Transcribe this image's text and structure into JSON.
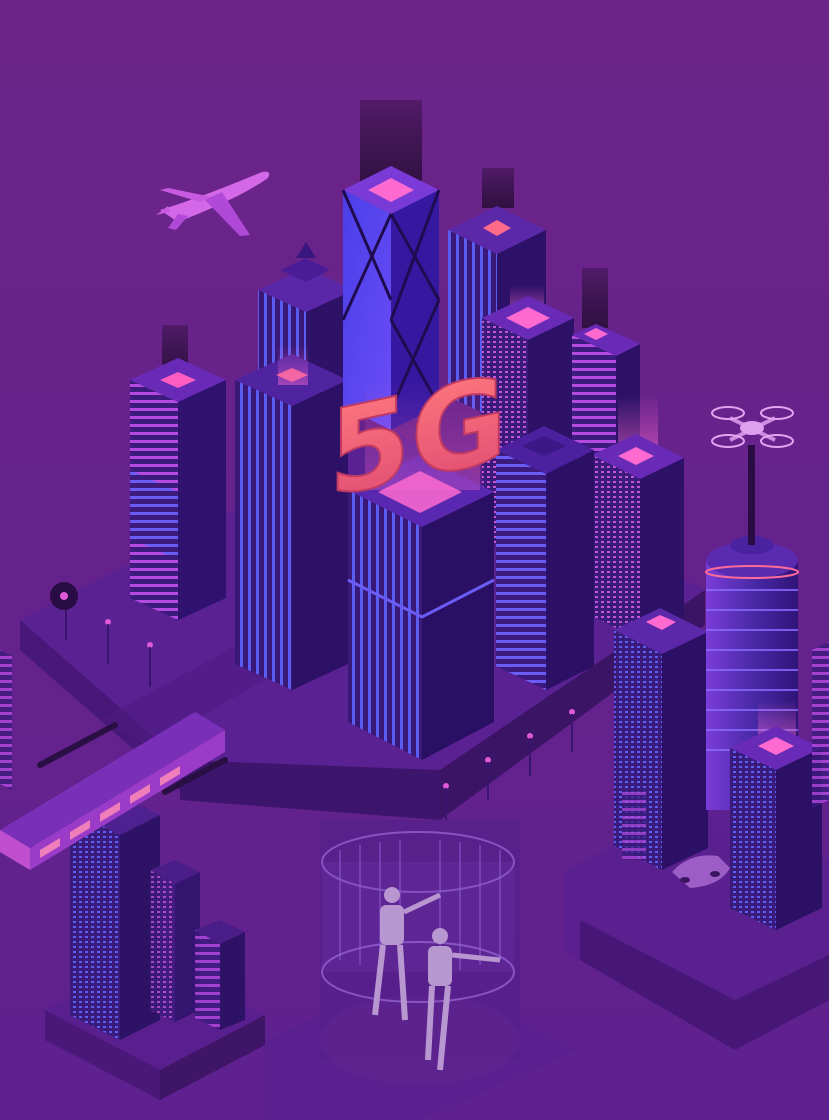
{
  "scene": {
    "description_label": "",
    "sign_text": "5G",
    "colors": {
      "background": "#6b2487",
      "platform_top": "#5a1f8a",
      "platform_side": "#461876",
      "building_dark": "#3e1a7a",
      "building_mid": "#4a2294",
      "window_blue": "#5b5cf0",
      "window_pink": "#e05ad8",
      "neon_pink": "#ff5aa0",
      "sign_red": "#f0607a",
      "glow_pink": "#ff6ad0"
    },
    "icons": [
      "airplane-icon",
      "drone-icon",
      "train-icon",
      "car-icon",
      "robot-icon",
      "street-lamp-icon"
    ]
  }
}
